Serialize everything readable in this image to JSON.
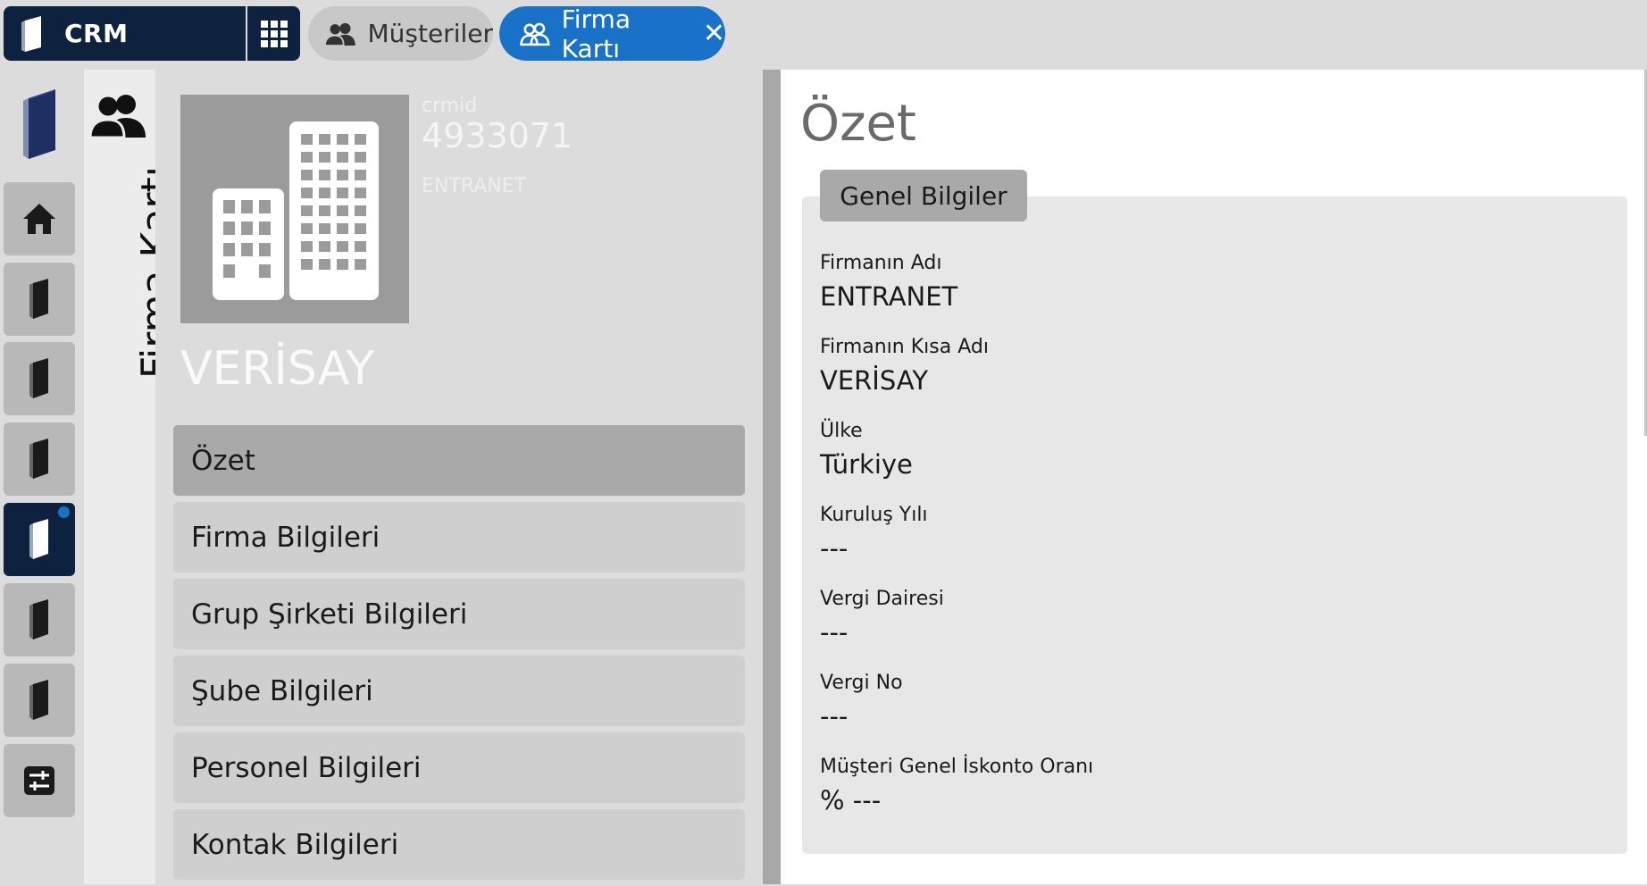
{
  "app": {
    "title": "CRM"
  },
  "tabs": [
    {
      "label": "Müşteriler",
      "active": false
    },
    {
      "label": "Firma Kartı",
      "active": true,
      "close_glyph": "✕"
    }
  ],
  "rail": {
    "items": [
      {
        "icon": "home-icon",
        "active": false
      },
      {
        "icon": "book-icon",
        "active": false
      },
      {
        "icon": "book-icon",
        "active": false
      },
      {
        "icon": "book-icon",
        "active": false
      },
      {
        "icon": "book-icon",
        "active": true,
        "notification": true
      },
      {
        "icon": "book-icon",
        "active": false
      },
      {
        "icon": "book-icon",
        "active": false
      },
      {
        "icon": "sliders-icon",
        "active": false
      }
    ]
  },
  "strip": {
    "title": "Firma Kartı",
    "icon": "users-icon"
  },
  "company": {
    "crm_label": "crmid",
    "crm_id": "4933071",
    "short_code": "ENTRANET",
    "name": "VERİSAY",
    "image_icon": "buildings-icon"
  },
  "menu": [
    {
      "label": "Özet",
      "active": true
    },
    {
      "label": "Firma Bilgileri",
      "active": false
    },
    {
      "label": "Grup Şirketi Bilgileri",
      "active": false
    },
    {
      "label": "Şube Bilgileri",
      "active": false
    },
    {
      "label": "Personel Bilgileri",
      "active": false
    },
    {
      "label": "Kontak Bilgileri",
      "active": false
    }
  ],
  "summary": {
    "title": "Özet",
    "section_tab": "Genel Bilgiler",
    "fields": [
      {
        "label": "Firmanın Adı",
        "value": "ENTRANET"
      },
      {
        "label": "Firmanın Kısa Adı",
        "value": "VERİSAY"
      },
      {
        "label": "Ülke",
        "value": "Türkiye"
      },
      {
        "label": "Kuruluş Yılı",
        "value": "---"
      },
      {
        "label": "Vergi Dairesi",
        "value": "---"
      },
      {
        "label": "Vergi No",
        "value": "---"
      },
      {
        "label": "Müşteri Genel İskonto Oranı",
        "value": "% ---"
      }
    ]
  },
  "colors": {
    "navy": "#0e223f",
    "accent_blue": "#1a72c8",
    "panel_gray": "#dcdcdc",
    "menu_item": "#cfcfcf",
    "menu_item_active": "#a9a9a9"
  }
}
